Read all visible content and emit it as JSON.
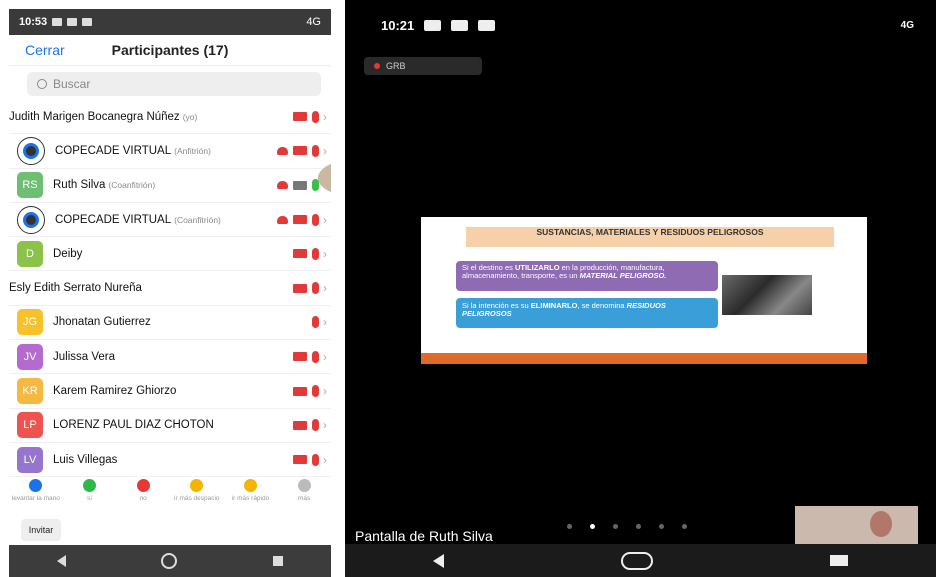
{
  "left": {
    "status_time": "10:53",
    "status_right": "4G",
    "close_label": "Cerrar",
    "title": "Participantes (17)",
    "search_placeholder": "Buscar",
    "participants": [
      {
        "initials": "",
        "name": "Judith Marigen Bocanegra Núñez",
        "role": "(yo)",
        "avatar_type": "photo",
        "rec": false,
        "video": "off",
        "mic": "off"
      },
      {
        "initials": "",
        "name": "COPECADE VIRTUAL",
        "role": "(Anfitrión)",
        "avatar_type": "logo",
        "rec": true,
        "video": "off",
        "mic": "off"
      },
      {
        "initials": "RS",
        "name": "Ruth Silva",
        "role": "(Coanfitrión)",
        "avatar_color": "#6fbf73",
        "rec": true,
        "video": "on",
        "mic": "on"
      },
      {
        "initials": "",
        "name": "COPECADE VIRTUAL",
        "role": "(Coanfitrión)",
        "avatar_type": "logo",
        "rec": true,
        "video": "off",
        "mic": "off"
      },
      {
        "initials": "D",
        "name": "Deiby",
        "role": "",
        "avatar_color": "#8bc34a",
        "rec": false,
        "video": "off",
        "mic": "off"
      },
      {
        "initials": "",
        "name": "Esly Edith Serrato Nureña",
        "role": "",
        "avatar_type": "photo",
        "rec": false,
        "video": "off",
        "mic": "off"
      },
      {
        "initials": "JG",
        "name": "Jhonatan Gutierrez",
        "role": "",
        "avatar_color": "#f6c12a",
        "rec": false,
        "video": "none",
        "mic": "off"
      },
      {
        "initials": "JV",
        "name": "Julissa Vera",
        "role": "",
        "avatar_color": "#b56ad0",
        "rec": false,
        "video": "off",
        "mic": "off"
      },
      {
        "initials": "KR",
        "name": "Karem Ramirez Ghiorzo",
        "role": "",
        "avatar_color": "#f5b942",
        "rec": false,
        "video": "off",
        "mic": "off"
      },
      {
        "initials": "LP",
        "name": "LORENZ PAUL DIAZ CHOTON",
        "role": "",
        "avatar_color": "#ef5350",
        "rec": false,
        "video": "off",
        "mic": "off"
      },
      {
        "initials": "LV",
        "name": "Luis Villegas",
        "role": "",
        "avatar_color": "#9575cd",
        "rec": false,
        "video": "off",
        "mic": "off"
      }
    ],
    "reactions": [
      {
        "label": "levantar la mano",
        "color": "#1a73e8"
      },
      {
        "label": "sí",
        "color": "#2eb84a"
      },
      {
        "label": "no",
        "color": "#e53935"
      },
      {
        "label": "ir más despacio",
        "color": "#f5b400"
      },
      {
        "label": "ir más rápido",
        "color": "#f5b400"
      },
      {
        "label": "más",
        "color": "#bbbbbb"
      }
    ],
    "invite_label": "Invitar"
  },
  "right": {
    "status_time": "10:21",
    "status_right": "4G",
    "rec_label": "GRB",
    "slide": {
      "title": "SUSTANCIAS, MATERIALES Y RESIDUOS PELIGROSOS",
      "box1_pre": "Si el destino es ",
      "box1_bold": "UTILIZARLO",
      "box1_post": " en la producción, manufactura, almacenamiento, transporte, es un ",
      "box1_em": "MATERIAL PELIGROSO.",
      "box2_pre": "Si la intención es su ",
      "box2_bold": "ELIMINARLO",
      "box2_mid": ", se denomina ",
      "box2_em": "RESIDUOS PELIGROSOS"
    },
    "share_label": "Pantalla de Ruth Silva"
  }
}
